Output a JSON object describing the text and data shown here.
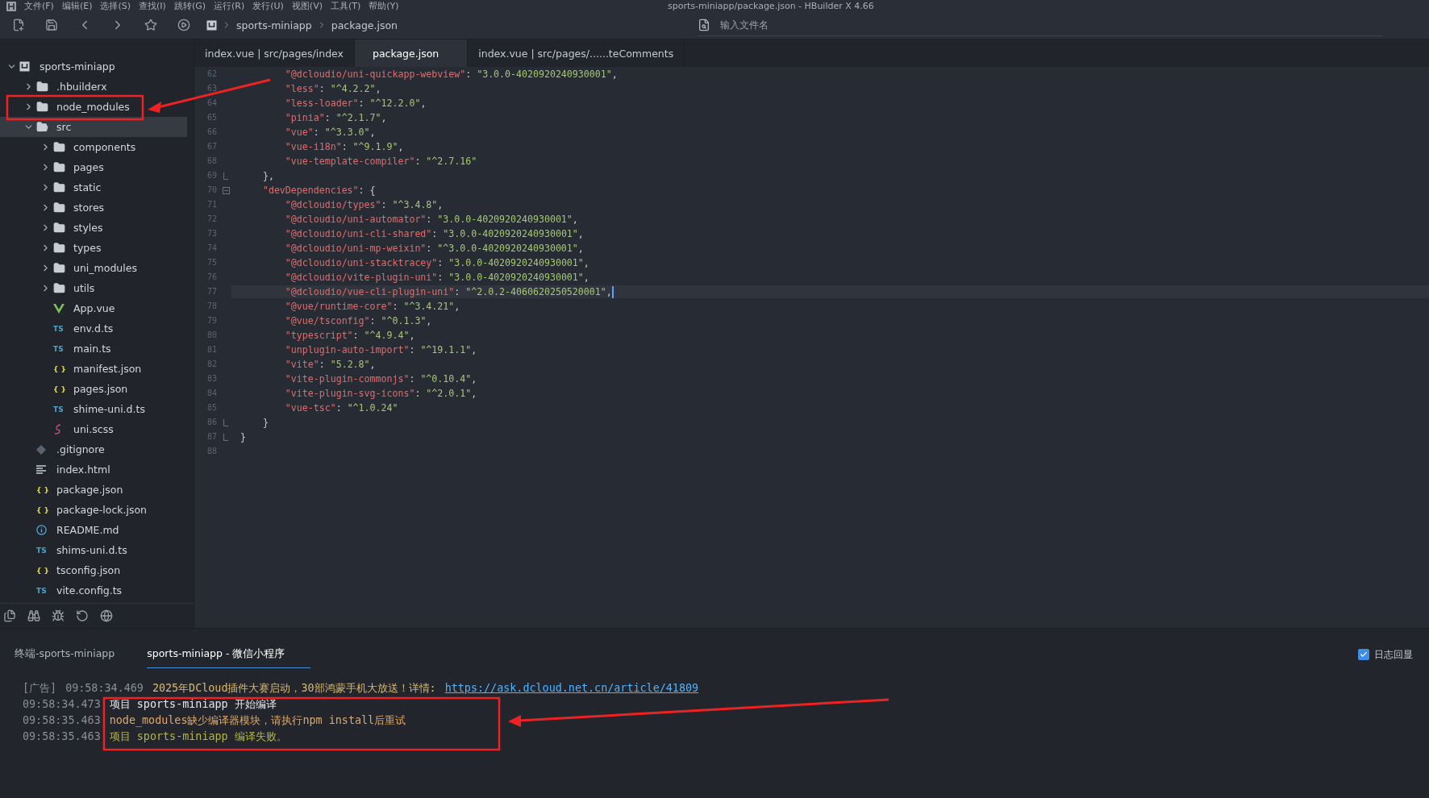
{
  "window": {
    "title": "sports-miniapp/package.json - HBuilder X 4.66"
  },
  "menu": [
    "文件(F)",
    "编辑(E)",
    "选择(S)",
    "查找(I)",
    "跳转(G)",
    "运行(R)",
    "发行(U)",
    "视图(V)",
    "工具(T)",
    "帮助(Y)"
  ],
  "breadcrumb": [
    "sports-miniapp",
    "package.json"
  ],
  "file_search": {
    "placeholder": "输入文件名"
  },
  "tree": [
    {
      "name": "sports-miniapp",
      "kind": "project",
      "expanded": true,
      "selected": false,
      "children": [
        {
          "name": ".hbuilderx",
          "kind": "folder",
          "expanded": false,
          "selected": false
        },
        {
          "name": "node_modules",
          "kind": "folder",
          "expanded": false,
          "selected": false
        },
        {
          "name": "src",
          "kind": "folder",
          "expanded": true,
          "selected": true,
          "children": [
            {
              "name": "components",
              "kind": "folder",
              "expanded": false,
              "selected": false
            },
            {
              "name": "pages",
              "kind": "folder",
              "expanded": false,
              "selected": false
            },
            {
              "name": "static",
              "kind": "folder",
              "expanded": false,
              "selected": false
            },
            {
              "name": "stores",
              "kind": "folder",
              "expanded": false,
              "selected": false
            },
            {
              "name": "styles",
              "kind": "folder",
              "expanded": false,
              "selected": false
            },
            {
              "name": "types",
              "kind": "folder",
              "expanded": false,
              "selected": false
            },
            {
              "name": "uni_modules",
              "kind": "folder",
              "expanded": false,
              "selected": false
            },
            {
              "name": "utils",
              "kind": "folder",
              "expanded": false,
              "selected": false
            },
            {
              "name": "App.vue",
              "kind": "vue",
              "selected": false
            },
            {
              "name": "env.d.ts",
              "kind": "badge",
              "badge": "TS",
              "selected": false
            },
            {
              "name": "main.ts",
              "kind": "badge",
              "badge": "TS",
              "selected": false
            },
            {
              "name": "manifest.json",
              "kind": "badge",
              "badge": "{ }",
              "selected": false
            },
            {
              "name": "pages.json",
              "kind": "badge",
              "badge": "{ }",
              "selected": false
            },
            {
              "name": "shime-uni.d.ts",
              "kind": "badge",
              "badge": "TS",
              "selected": false
            },
            {
              "name": "uni.scss",
              "kind": "scss",
              "selected": false
            }
          ]
        },
        {
          "name": ".gitignore",
          "kind": "git",
          "selected": false
        },
        {
          "name": "index.html",
          "kind": "lines",
          "selected": false
        },
        {
          "name": "package.json",
          "kind": "badge",
          "badge": "{ }",
          "selected": false
        },
        {
          "name": "package-lock.json",
          "kind": "badge",
          "badge": "{ }",
          "selected": false
        },
        {
          "name": "README.md",
          "kind": "info",
          "selected": false
        },
        {
          "name": "shims-uni.d.ts",
          "kind": "badge",
          "badge": "TS",
          "selected": false
        },
        {
          "name": "tsconfig.json",
          "kind": "badge",
          "badge": "{ }",
          "selected": false
        },
        {
          "name": "vite.config.ts",
          "kind": "badge",
          "badge": "TS",
          "selected": false
        }
      ]
    }
  ],
  "editor_tabs": [
    {
      "label": "index.vue | src/pages/index",
      "selected": false
    },
    {
      "label": "package.json",
      "selected": true
    },
    {
      "label": "index.vue | src/pages/......teComments",
      "selected": false
    }
  ],
  "code": [
    {
      "number": "62",
      "kind": "plain",
      "current": false,
      "parts": [
        {
          "kind": "key",
          "text": "        \"@dcloudio/uni-quickapp-webview\""
        },
        {
          "kind": "punct",
          "text": ": "
        },
        {
          "kind": "string",
          "text": "\"3.0.0-4020920240930001\""
        },
        {
          "kind": "punct",
          "text": ","
        }
      ]
    },
    {
      "number": "63",
      "kind": "plain",
      "current": false,
      "parts": [
        {
          "kind": "key",
          "text": "        \"less\""
        },
        {
          "kind": "punct",
          "text": ": "
        },
        {
          "kind": "string",
          "text": "\"^4.2.2\""
        },
        {
          "kind": "punct",
          "text": ","
        }
      ]
    },
    {
      "number": "64",
      "kind": "plain",
      "current": false,
      "parts": [
        {
          "kind": "key",
          "text": "        \"less-loader\""
        },
        {
          "kind": "punct",
          "text": ": "
        },
        {
          "kind": "string",
          "text": "\"^12.2.0\""
        },
        {
          "kind": "punct",
          "text": ","
        }
      ]
    },
    {
      "number": "65",
      "kind": "plain",
      "current": false,
      "parts": [
        {
          "kind": "key",
          "text": "        \"pinia\""
        },
        {
          "kind": "punct",
          "text": ": "
        },
        {
          "kind": "string",
          "text": "\"^2.1.7\""
        },
        {
          "kind": "punct",
          "text": ","
        }
      ]
    },
    {
      "number": "66",
      "kind": "plain",
      "current": false,
      "parts": [
        {
          "kind": "key",
          "text": "        \"vue\""
        },
        {
          "kind": "punct",
          "text": ": "
        },
        {
          "kind": "string",
          "text": "\"^3.3.0\""
        },
        {
          "kind": "punct",
          "text": ","
        }
      ]
    },
    {
      "number": "67",
      "kind": "plain",
      "current": false,
      "parts": [
        {
          "kind": "key",
          "text": "        \"vue-i18n\""
        },
        {
          "kind": "punct",
          "text": ": "
        },
        {
          "kind": "string",
          "text": "\"^9.1.9\""
        },
        {
          "kind": "punct",
          "text": ","
        }
      ]
    },
    {
      "number": "68",
      "kind": "plain",
      "current": false,
      "parts": [
        {
          "kind": "key",
          "text": "        \"vue-template-compiler\""
        },
        {
          "kind": "punct",
          "text": ": "
        },
        {
          "kind": "string",
          "text": "\"^2.7.16\""
        }
      ]
    },
    {
      "number": "69",
      "kind": "fold-end",
      "current": false,
      "parts": [
        {
          "kind": "punct",
          "text": "    },"
        }
      ]
    },
    {
      "number": "70",
      "kind": "fold-start",
      "current": false,
      "parts": [
        {
          "kind": "key",
          "text": "    \"devDependencies\""
        },
        {
          "kind": "punct",
          "text": ": {"
        }
      ]
    },
    {
      "number": "71",
      "kind": "plain",
      "current": false,
      "parts": [
        {
          "kind": "key",
          "text": "        \"@dcloudio/types\""
        },
        {
          "kind": "punct",
          "text": ": "
        },
        {
          "kind": "string",
          "text": "\"^3.4.8\""
        },
        {
          "kind": "punct",
          "text": ","
        }
      ]
    },
    {
      "number": "72",
      "kind": "plain",
      "current": false,
      "parts": [
        {
          "kind": "key",
          "text": "        \"@dcloudio/uni-automator\""
        },
        {
          "kind": "punct",
          "text": ": "
        },
        {
          "kind": "string",
          "text": "\"3.0.0-4020920240930001\""
        },
        {
          "kind": "punct",
          "text": ","
        }
      ]
    },
    {
      "number": "73",
      "kind": "plain",
      "current": false,
      "parts": [
        {
          "kind": "key",
          "text": "        \"@dcloudio/uni-cli-shared\""
        },
        {
          "kind": "punct",
          "text": ": "
        },
        {
          "kind": "string",
          "text": "\"3.0.0-4020920240930001\""
        },
        {
          "kind": "punct",
          "text": ","
        }
      ]
    },
    {
      "number": "74",
      "kind": "plain",
      "current": false,
      "parts": [
        {
          "kind": "key",
          "text": "        \"@dcloudio/uni-mp-weixin\""
        },
        {
          "kind": "punct",
          "text": ": "
        },
        {
          "kind": "string",
          "text": "\"^3.0.0-4020920240930001\""
        },
        {
          "kind": "punct",
          "text": ","
        }
      ]
    },
    {
      "number": "75",
      "kind": "plain",
      "current": false,
      "parts": [
        {
          "kind": "key",
          "text": "        \"@dcloudio/uni-stacktracey\""
        },
        {
          "kind": "punct",
          "text": ": "
        },
        {
          "kind": "string",
          "text": "\"3.0.0-4020920240930001\""
        },
        {
          "kind": "punct",
          "text": ","
        }
      ]
    },
    {
      "number": "76",
      "kind": "plain",
      "current": false,
      "parts": [
        {
          "kind": "key",
          "text": "        \"@dcloudio/vite-plugin-uni\""
        },
        {
          "kind": "punct",
          "text": ": "
        },
        {
          "kind": "string",
          "text": "\"3.0.0-4020920240930001\""
        },
        {
          "kind": "punct",
          "text": ","
        }
      ]
    },
    {
      "number": "77",
      "kind": "plain",
      "current": true,
      "parts": [
        {
          "kind": "key",
          "text": "        \"@dcloudio/vue-cli-plugin-uni\""
        },
        {
          "kind": "punct",
          "text": ": "
        },
        {
          "kind": "string",
          "text": "\"^2.0.2-4060620250520001\""
        },
        {
          "kind": "punct",
          "text": ","
        }
      ]
    },
    {
      "number": "78",
      "kind": "plain",
      "current": false,
      "parts": [
        {
          "kind": "key",
          "text": "        \"@vue/runtime-core\""
        },
        {
          "kind": "punct",
          "text": ": "
        },
        {
          "kind": "string",
          "text": "\"^3.4.21\""
        },
        {
          "kind": "punct",
          "text": ","
        }
      ]
    },
    {
      "number": "79",
      "kind": "plain",
      "current": false,
      "parts": [
        {
          "kind": "key",
          "text": "        \"@vue/tsconfig\""
        },
        {
          "kind": "punct",
          "text": ": "
        },
        {
          "kind": "string",
          "text": "\"^0.1.3\""
        },
        {
          "kind": "punct",
          "text": ","
        }
      ]
    },
    {
      "number": "80",
      "kind": "plain",
      "current": false,
      "parts": [
        {
          "kind": "key",
          "text": "        \"typescript\""
        },
        {
          "kind": "punct",
          "text": ": "
        },
        {
          "kind": "string",
          "text": "\"^4.9.4\""
        },
        {
          "kind": "punct",
          "text": ","
        }
      ]
    },
    {
      "number": "81",
      "kind": "plain",
      "current": false,
      "parts": [
        {
          "kind": "key",
          "text": "        \"unplugin-auto-import\""
        },
        {
          "kind": "punct",
          "text": ": "
        },
        {
          "kind": "string",
          "text": "\"^19.1.1\""
        },
        {
          "kind": "punct",
          "text": ","
        }
      ]
    },
    {
      "number": "82",
      "kind": "plain",
      "current": false,
      "parts": [
        {
          "kind": "key",
          "text": "        \"vite\""
        },
        {
          "kind": "punct",
          "text": ": "
        },
        {
          "kind": "string",
          "text": "\"5.2.8\""
        },
        {
          "kind": "punct",
          "text": ","
        }
      ]
    },
    {
      "number": "83",
      "kind": "plain",
      "current": false,
      "parts": [
        {
          "kind": "key",
          "text": "        \"vite-plugin-commonjs\""
        },
        {
          "kind": "punct",
          "text": ": "
        },
        {
          "kind": "string",
          "text": "\"^0.10.4\""
        },
        {
          "kind": "punct",
          "text": ","
        }
      ]
    },
    {
      "number": "84",
      "kind": "plain",
      "current": false,
      "parts": [
        {
          "kind": "key",
          "text": "        \"vite-plugin-svg-icons\""
        },
        {
          "kind": "punct",
          "text": ": "
        },
        {
          "kind": "string",
          "text": "\"^2.0.1\""
        },
        {
          "kind": "punct",
          "text": ","
        }
      ]
    },
    {
      "number": "85",
      "kind": "plain",
      "current": false,
      "parts": [
        {
          "kind": "key",
          "text": "        \"vue-tsc\""
        },
        {
          "kind": "punct",
          "text": ": "
        },
        {
          "kind": "string",
          "text": "\"^1.0.24\""
        }
      ]
    },
    {
      "number": "86",
      "kind": "fold-end",
      "current": false,
      "parts": [
        {
          "kind": "punct",
          "text": "    }"
        }
      ]
    },
    {
      "number": "87",
      "kind": "fold-end",
      "current": false,
      "parts": [
        {
          "kind": "punct",
          "text": "}"
        }
      ]
    },
    {
      "number": "88",
      "kind": "plain",
      "current": false
    }
  ],
  "console": {
    "tabs": [
      {
        "label": "终端-sports-miniapp",
        "selected": false
      },
      {
        "label": "sports-miniapp - 微信小程序",
        "selected": true
      }
    ],
    "echo": {
      "label": "日志回显",
      "checked": true
    },
    "lines": [
      {
        "tag": "[广告]",
        "time": "09:58:34.469",
        "kind": "ad",
        "message": "2025年DCloud插件大赛启动，30部鸿蒙手机大放送！详情:",
        "link": "https://ask.dcloud.net.cn/article/41809"
      },
      {
        "time": "09:58:34.473",
        "kind": "info",
        "message": "项目 sports-miniapp 开始编译"
      },
      {
        "time": "09:58:35.463",
        "kind": "warning",
        "message": "node_modules缺少编译器模块，请执行npm install后重试"
      },
      {
        "time": "09:58:35.463",
        "kind": "failure",
        "message": "项目 sports-miniapp 编译失败。"
      }
    ]
  }
}
